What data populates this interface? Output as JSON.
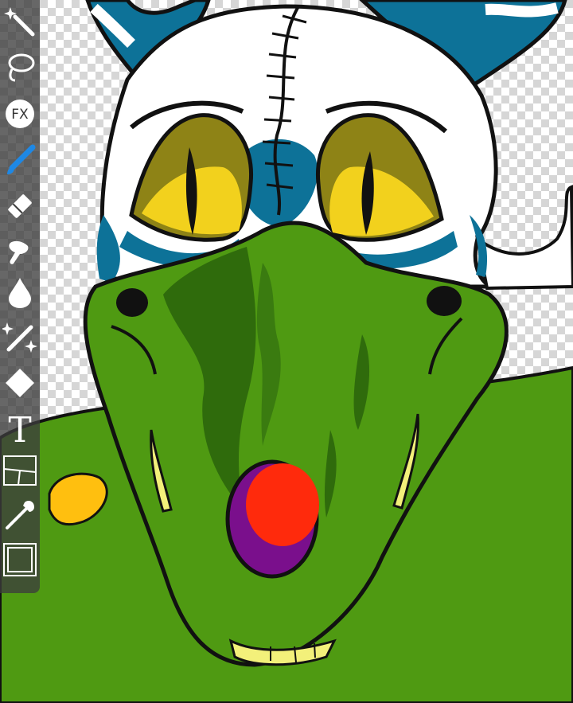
{
  "app": {
    "toolbar": {
      "tools": [
        {
          "id": "magic-wand",
          "icon": "magic-wand-icon"
        },
        {
          "id": "lasso",
          "icon": "lasso-icon"
        },
        {
          "id": "fx",
          "icon": "fx-icon",
          "label": "FX"
        },
        {
          "id": "brush",
          "icon": "brush-icon",
          "active": true
        },
        {
          "id": "eraser",
          "icon": "eraser-icon"
        },
        {
          "id": "smudge",
          "icon": "smudge-icon"
        },
        {
          "id": "blur",
          "icon": "blur-drop-icon"
        },
        {
          "id": "sparkle-brush",
          "icon": "sparkle-brush-icon"
        },
        {
          "id": "fill",
          "icon": "fill-icon"
        },
        {
          "id": "text",
          "icon": "text-icon",
          "label": "T"
        },
        {
          "id": "frame-divider",
          "icon": "frame-divider-icon"
        },
        {
          "id": "eyedropper",
          "icon": "eyedropper-icon"
        },
        {
          "id": "canvas",
          "icon": "canvas-icon"
        }
      ]
    },
    "colors": {
      "toolbar_bg": "#3c3c3c",
      "active_tool": "#1e88e5",
      "skin_green": "#4f9a12",
      "dark_green": "#2f6b0c",
      "mask_white": "#ffffff",
      "mask_blue": "#0d7298",
      "eye_yellow": "#f2d11d",
      "eye_olive": "#8e8316",
      "nose_red": "#ff2a0c",
      "nose_purple": "#7a0f8c",
      "teeth_yellow": "#f3f07a",
      "orange_spot": "#ffbf0f"
    }
  }
}
